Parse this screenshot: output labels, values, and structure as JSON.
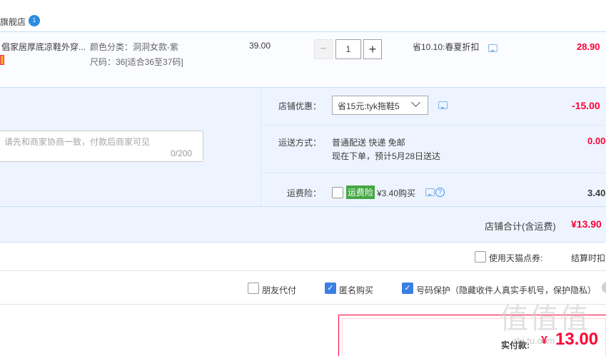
{
  "shop": {
    "name": "旗舰店",
    "ww_icon": "ww-chat-icon",
    "ww_icon_glyph": "1"
  },
  "item": {
    "title": "倡家居厚底凉鞋外穿...",
    "sku_color": "颜色分类：洞洞女款-紫",
    "sku_size": "尺码：36[适合36至37码]",
    "unit_price": "39.00",
    "quantity": "1",
    "qty_minus": "−",
    "qty_plus": "+",
    "promo": "省10.10:春夏折扣",
    "total": "28.90"
  },
  "message": {
    "placeholder": "请先和商家协商一致，付款后商家可见",
    "counter": "0/200"
  },
  "options": {
    "shop_promo_label": "店铺优惠：",
    "shop_promo_selected": "省15元:tyk拖鞋5",
    "shop_promo_value": "-15.00",
    "shipping_label": "运送方式：",
    "shipping_method": "普通配送 快递 免邮",
    "shipping_eta": "现在下单，预计5月28日送达",
    "shipping_value": "0.00",
    "insurance_label": "运费险：",
    "insurance_badge": "运费险",
    "insurance_price": "¥3.40购买",
    "insurance_value": "3.40"
  },
  "shop_total": {
    "label": "店铺合计(含运费)",
    "value": "¥13.90"
  },
  "coupon": {
    "label": "使用天猫点券:",
    "checkout_time": "结算时扣"
  },
  "payment_options": {
    "friend_pay": "朋友代付",
    "anonymous": "匿名购买",
    "phone_protect": "号码保护（隐藏收件人真实手机号，保护隐私）",
    "check_glyph": "✓"
  },
  "pay": {
    "label": "实付款:",
    "currency": "¥",
    "amount": "13.00"
  },
  "watermark": {
    "text": "值值值",
    "sub": "zhi.tu.com"
  },
  "colors": {
    "price_red": "#ff0036",
    "link_blue": "#3c7fe3",
    "panel_bg": "#eef4ff",
    "badge_green": "#44a742"
  }
}
